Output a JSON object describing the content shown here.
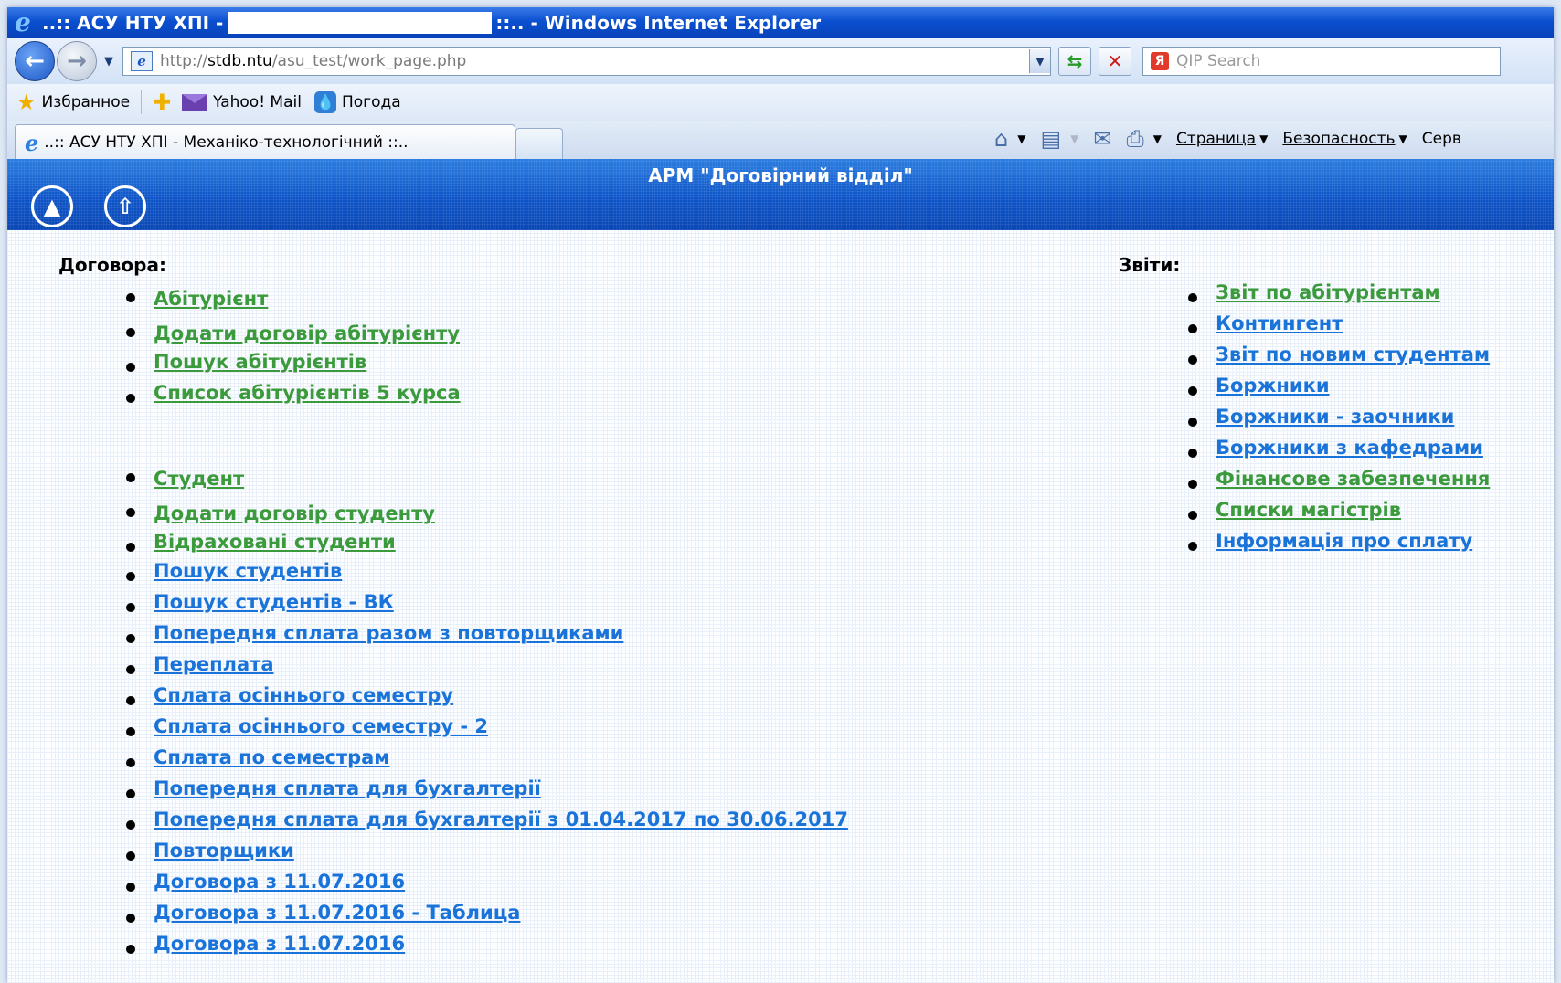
{
  "window": {
    "title_prefix": "..:: АСУ НТУ ХПІ -",
    "title_suffix": "::.. - Windows Internet Explorer"
  },
  "toolbar": {
    "address": {
      "scheme": "http://",
      "host": "stdb.ntu",
      "path": "/asu_test/work_page.php"
    },
    "search_placeholder": "QIP Search",
    "search_logo": "Я"
  },
  "favorites": {
    "favorites_label": "Избранное",
    "links": [
      "Yahoo! Mail",
      "Погода"
    ]
  },
  "tabs": {
    "active_title": "..:: АСУ НТУ ХПІ - Механіко-технологічний ::.."
  },
  "commands": {
    "page": "Страница",
    "security": "Безопасность",
    "service_partial": "Серв"
  },
  "app": {
    "title": "АРМ \"Договірний відділ\"",
    "left_button_icon": "triangle-home-icon",
    "right_button_icon": "up-arrow-icon"
  },
  "contracts": {
    "heading": "Договора:",
    "group1": [
      "Абітурієнт",
      "Додати договір абітурієнту",
      "Пошук абітурієнтів",
      "Список абітурієнтів 5 курса"
    ],
    "group2_green": [
      "Студент",
      "Додати договір студенту",
      "Відраховані студенти"
    ],
    "group2_blue": [
      "Пошук студентів",
      "Пошук студентів - ВК",
      "Попередня сплата разом з повторщиками",
      "Переплата",
      "Сплата осіннього семестру",
      "Сплата осіннього семестру - 2",
      "Сплата по семестрам",
      "Попередня сплата для бухгалтерії",
      "Попередня сплата для бухгалтерії з 01.04.2017 по 30.06.2017",
      "Повторщики",
      "Договора з 11.07.2016",
      "Договора з 11.07.2016 - Таблица",
      "Договора з 11.07.2016"
    ]
  },
  "reports": {
    "heading": "Звіти:",
    "green": [
      "Звіт по абітурієнтам"
    ],
    "blue": [
      "Контингент",
      "Звіт по новим студентам",
      "Боржники",
      "Боржники - заочники",
      "Боржники з кафедрами"
    ],
    "green2": [
      "Фінансове забезпечення",
      "Списки магістрів"
    ],
    "blue2": [
      "Інформація про сплату"
    ]
  }
}
